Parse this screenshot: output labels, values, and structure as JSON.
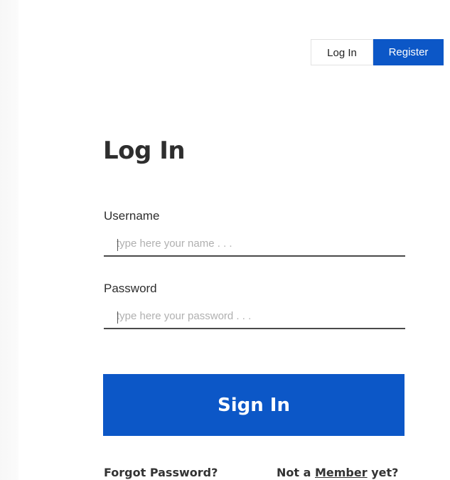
{
  "header": {
    "login_tab": "Log In",
    "register_tab": "Register"
  },
  "form": {
    "title": "Log In",
    "username_label": "Username",
    "username_placeholder": "type here your name . . .",
    "password_label": "Password",
    "password_placeholder": "type here your password . . .",
    "submit_label": "Sign In"
  },
  "footer": {
    "forgot_password": "Forgot Password?",
    "not_a": "Not a",
    "member_link": "Member",
    "yet": "yet?"
  },
  "colors": {
    "accent": "#0c57c7",
    "text": "#2e2e2e"
  }
}
